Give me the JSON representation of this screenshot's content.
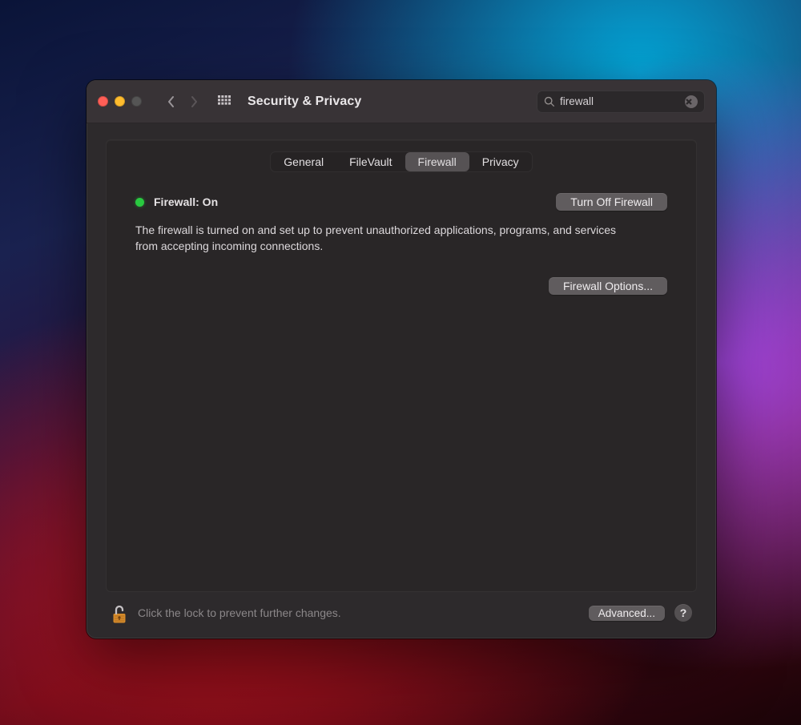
{
  "window": {
    "title": "Security & Privacy"
  },
  "search": {
    "value": "firewall"
  },
  "tabs": [
    {
      "label": "General",
      "active": false
    },
    {
      "label": "FileVault",
      "active": false
    },
    {
      "label": "Firewall",
      "active": true
    },
    {
      "label": "Privacy",
      "active": false
    }
  ],
  "firewall": {
    "status_label": "Firewall: On",
    "status_color": "#29c940",
    "turn_off_label": "Turn Off Firewall",
    "description": "The firewall is turned on and set up to prevent unauthorized applications, programs, and services from accepting incoming connections.",
    "options_label": "Firewall Options..."
  },
  "footer": {
    "lock_hint": "Click the lock to prevent further changes.",
    "advanced_label": "Advanced...",
    "help_label": "?"
  }
}
